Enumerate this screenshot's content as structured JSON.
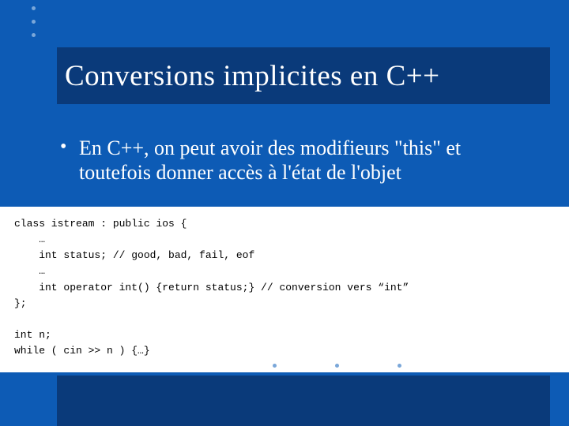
{
  "title": "Conversions implicites en C++",
  "bullet": "En C++, on peut avoir des modifieurs \"this\" et toutefois donner accès à l'état de l'objet",
  "code_lines": [
    "class istream : public ios {",
    "    …",
    "    int status; // good, bad, fail, eof",
    "    …",
    "    int operator int() {return status;} // conversion vers “int”",
    "};",
    "",
    "int n;",
    "while ( cin >> n ) {…}"
  ]
}
